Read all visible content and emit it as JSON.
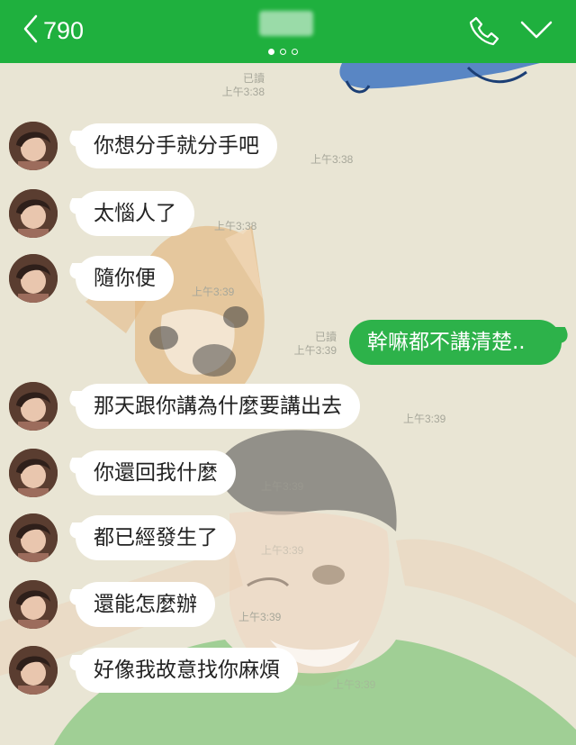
{
  "header": {
    "back_count": "790",
    "page_dots": 3,
    "active_dot": 0
  },
  "colors": {
    "header": "#1fb03e",
    "outgoing_bubble": "#2db24a",
    "incoming_bubble": "#ffffff",
    "chat_bg": "#e9e5d4"
  },
  "icons": [
    "chevron-left-icon",
    "phone-icon",
    "chevron-down-icon"
  ],
  "messages": [
    {
      "side": "out",
      "text": "",
      "read": "已讀",
      "time": "上午3:38"
    },
    {
      "side": "in",
      "text": "你想分手就分手吧",
      "time": "上午3:38"
    },
    {
      "side": "in",
      "text": "太惱人了",
      "time": "上午3:38"
    },
    {
      "side": "in",
      "text": "隨你便",
      "time": "上午3:39"
    },
    {
      "side": "out",
      "text": "幹嘛都不講清楚..",
      "read": "已讀",
      "time": "上午3:39"
    },
    {
      "side": "in",
      "text": "那天跟你講為什麼要講出去",
      "time": "上午3:39"
    },
    {
      "side": "in",
      "text": "你還回我什麼",
      "time": "上午3:39"
    },
    {
      "side": "in",
      "text": "都已經發生了",
      "time": "上午3:39"
    },
    {
      "side": "in",
      "text": "還能怎麼辦",
      "time": "上午3:39"
    },
    {
      "side": "in",
      "text": "好像我故意找你麻煩",
      "time": "上午3:39"
    }
  ]
}
